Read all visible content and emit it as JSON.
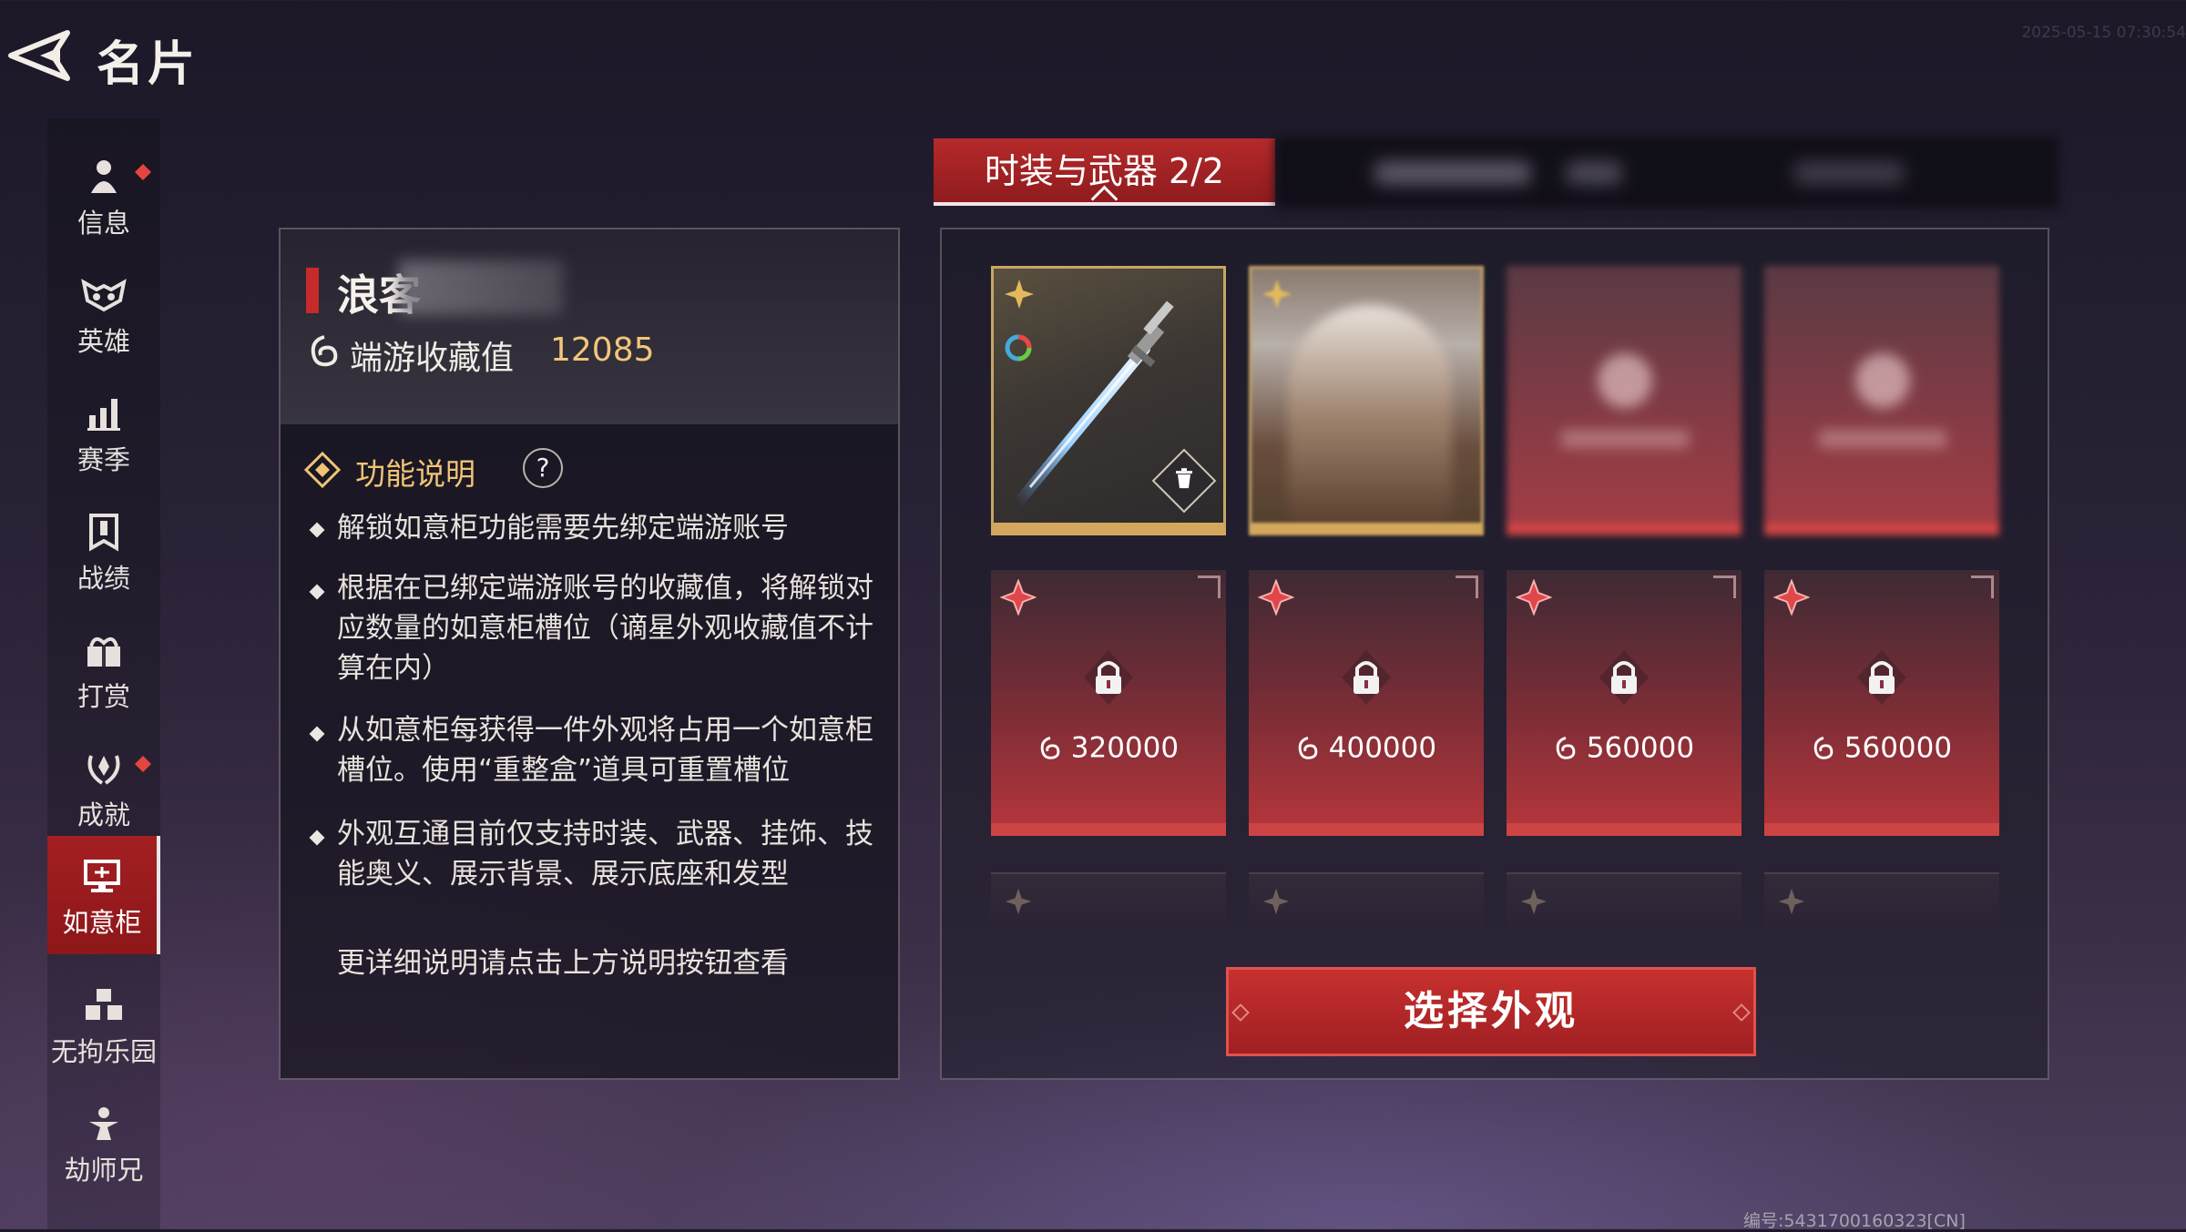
{
  "header": {
    "title": "名片",
    "timestamp": "2025-05-15 07:30:54"
  },
  "sidebar": {
    "items": [
      {
        "label": "信息",
        "icon": "person-icon",
        "badge": true
      },
      {
        "label": "英雄",
        "icon": "mask-icon",
        "badge": false
      },
      {
        "label": "赛季",
        "icon": "bar-chart-icon",
        "badge": false
      },
      {
        "label": "战绩",
        "icon": "banner-icon",
        "badge": false
      },
      {
        "label": "打赏",
        "icon": "gift-icon",
        "badge": false
      },
      {
        "label": "成就",
        "icon": "laurel-icon",
        "badge": true
      },
      {
        "label": "如意柜",
        "icon": "display-cabinet-icon",
        "badge": false,
        "active": true
      },
      {
        "label": "无拘乐园",
        "icon": "blocks-icon",
        "badge": false
      },
      {
        "label": "劫师兄",
        "icon": "figure-icon",
        "badge": false
      }
    ]
  },
  "info": {
    "player_name": "浪客",
    "collection_label": "端游收藏值",
    "collection_value": "12085",
    "func_label": "功能说明",
    "help_label": "?",
    "bullets": [
      "解锁如意柜功能需要先绑定端游账号",
      "根据在已绑定端游账号的收藏值，将解锁对应数量的如意柜槽位（谪星外观收藏值不计算在内）",
      "从如意柜每获得一件外观将占用一个如意柜槽位。使用“重整盒”道具可重置槽位",
      "外观互通目前仅支持时装、武器、挂饰、技能奥义、展示背景、展示底座和发型"
    ],
    "more_text": "更详细说明请点击上方说明按钮查看"
  },
  "tabs": {
    "active_label": "时装与武器 2/2"
  },
  "slots": {
    "locked": [
      {
        "cost": "320000"
      },
      {
        "cost": "400000"
      },
      {
        "cost": "560000"
      },
      {
        "cost": "560000"
      }
    ]
  },
  "select_button": "选择外观",
  "footer": {
    "id_text": "编号:5431700160323[CN]"
  },
  "colors": {
    "accent_red": "#b62a2a",
    "gold": "#f2c679",
    "slot_gold": "#d4a85c"
  }
}
